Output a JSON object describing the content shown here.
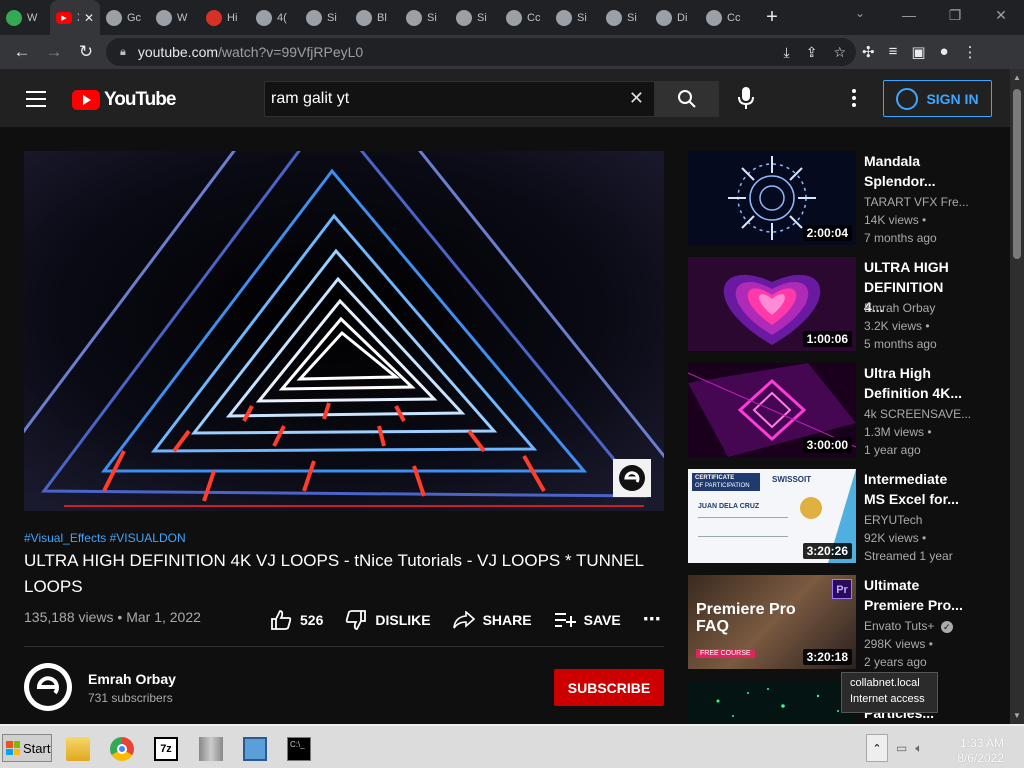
{
  "browser": {
    "tabs": [
      {
        "title": "W",
        "icon": "drive-icon",
        "color": "#34a853"
      },
      {
        "title": "X",
        "icon": "youtube-icon",
        "color": "#ff0000",
        "active": true
      },
      {
        "title": "Gc",
        "icon": "globe-icon",
        "color": "#9aa0a6"
      },
      {
        "title": "W",
        "icon": "wordpress-icon",
        "color": "#9aa0a6"
      },
      {
        "title": "Hi",
        "icon": "rapid-icon",
        "color": "#d93025"
      },
      {
        "title": "4(",
        "icon": "globe-icon",
        "color": "#9aa0a6"
      },
      {
        "title": "Si",
        "icon": "globe-icon",
        "color": "#9aa0a6"
      },
      {
        "title": "Bl",
        "icon": "globe-icon",
        "color": "#9aa0a6"
      },
      {
        "title": "Si",
        "icon": "globe-icon",
        "color": "#9aa0a6"
      },
      {
        "title": "Si",
        "icon": "globe-icon",
        "color": "#9aa0a6"
      },
      {
        "title": "Cc",
        "icon": "badge-icon",
        "color": "#9aa0a6"
      },
      {
        "title": "Si",
        "icon": "globe-icon",
        "color": "#9aa0a6"
      },
      {
        "title": "Si",
        "icon": "globe-icon",
        "color": "#9aa0a6"
      },
      {
        "title": "Di",
        "icon": "download-icon",
        "color": "#9aa0a6"
      },
      {
        "title": "Cc",
        "icon": "badge-icon",
        "color": "#9aa0a6"
      }
    ],
    "url_host": "youtube.com",
    "url_path": "/watch?v=99VfjRPeyL0"
  },
  "youtube": {
    "logo_text": "YouTube",
    "search_value": "ram galit yt",
    "signin_label": "SIGN IN",
    "video": {
      "hashtags": "#Visual_Effects #VISUALDON",
      "title": "ULTRA HIGH DEFINITION 4K VJ LOOPS - tNice Tutorials - VJ LOOPS * TUNNEL LOOPS",
      "views": "135,188 views",
      "date": "Mar 1, 2022",
      "meta_sep": " • ",
      "likes": "526",
      "dislike_label": "DISLIKE",
      "share_label": "SHARE",
      "save_label": "SAVE"
    },
    "channel": {
      "name": "Emrah Orbay",
      "subscribers": "731 subscribers",
      "subscribe_label": "SUBSCRIBE"
    },
    "recommendations": [
      {
        "title": "Mandala Splendor...",
        "channel": "TARART VFX Fre...",
        "views": "14K views •",
        "ago": "7 months ago",
        "duration": "2:00:04"
      },
      {
        "title": "ULTRA HIGH DEFINITION 4...",
        "channel": "Emrah Orbay",
        "views": "3.2K views •",
        "ago": "5 months ago",
        "duration": "1:00:06"
      },
      {
        "title": "Ultra High Definition 4K...",
        "channel": "4k SCREENSAVE...",
        "views": "1.3M views •",
        "ago": "1 year ago",
        "duration": "3:00:00"
      },
      {
        "title": "Intermediate MS Excel for...",
        "channel": "ERYUTech",
        "views": "92K views •",
        "ago": "Streamed 1 year",
        "duration": "3:20:26"
      },
      {
        "title": "Ultimate Premiere Pro...",
        "channel": "Envato Tuts+",
        "views": "298K views •",
        "ago": "2 years ago",
        "duration": "3:20:18"
      },
      {
        "title": "Particles...",
        "channel": "",
        "views": "",
        "ago": "",
        "duration": ""
      }
    ],
    "thumb_texts": {
      "cert_title": "CERTIFICATE",
      "cert_sub": "OF PARTICIPATION",
      "cert_brand": "SWISSOIT",
      "cert_name": "JUAN DELA CRUZ",
      "premiere_text": "Premiere Pro FAQ",
      "pr_badge": "Pr",
      "free_course": "FREE COURSE"
    }
  },
  "tooltip": {
    "line1": "collabnet.local",
    "line2": "Internet access"
  },
  "taskbar": {
    "start_label": "Start",
    "time": "1:33 AM",
    "date": "8/6/2022"
  }
}
